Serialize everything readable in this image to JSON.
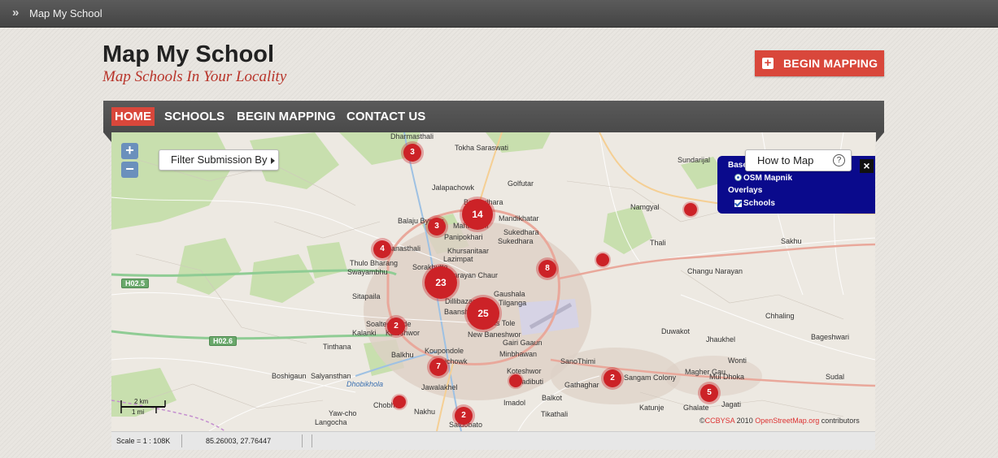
{
  "topbar": {
    "title": "Map My School"
  },
  "brand": {
    "title": "Map My School",
    "subtitle": "Map Schools In Your Locality"
  },
  "header": {
    "begin_mapping_label": "BEGIN MAPPING"
  },
  "nav": {
    "items": [
      "HOME",
      "SCHOOLS",
      "BEGIN MAPPING",
      "CONTACT US"
    ],
    "active": "HOME"
  },
  "map": {
    "zoom_in": "+",
    "zoom_out": "−",
    "filter_label": "Filter Submission By",
    "howto_label": "How to Map",
    "help_glyph": "?",
    "close_glyph": "×",
    "layers": {
      "base_header": "Base Layer",
      "base_option": "OSM Mapnik",
      "overlay_header": "Overlays",
      "overlay_option": "Schools"
    },
    "clusters": [
      "3",
      "14",
      "3",
      "4",
      "8",
      "23",
      "25",
      "2",
      "7",
      "2",
      "5",
      "2"
    ],
    "places": [
      "Dharmasthali",
      "Tokha Saraswati",
      "Golfutar",
      "Jalapachowk",
      "Basundhara",
      "Balaju Bypass",
      "Mahalaxmi",
      "Mandikhatar",
      "Panipokhari",
      "Sukedhara",
      "Sukedhara",
      "Khursanitaar",
      "Lazimpat",
      "Banasthali",
      "Thulo Bharang",
      "Swayambhu",
      "Sorakhutte",
      "Narayan Chaur",
      "Sitapaila",
      "Gaushala",
      "Dillibazar",
      "Tilganga",
      "Baanshghari",
      "Gurans Tole",
      "Soaltee Mode",
      "Kalanki",
      "Kuleshwor",
      "New Baneshwor",
      "Gairi Gaaun",
      "Tinthana",
      "Balkhu",
      "Koupondole",
      "Minbhawan",
      "SanoThimi",
      "Lichowk",
      "Koteshwor",
      "Boshigaun",
      "Salyansthan",
      "Jawalakhel",
      "Jadibuti",
      "Gathaghar",
      "Sangam Colony",
      "Chobhar",
      "Nakhu",
      "Imadol",
      "Balkot",
      "Yaw-cho",
      "Langocha",
      "Tikathali",
      "Satdobato",
      "Sundarijal",
      "Namgyal",
      "Thali",
      "Sakhu",
      "Changu Narayan",
      "Chhaling",
      "Duwakot",
      "Jhaukhel",
      "Bageshwari",
      "Wonti",
      "Magher Gau",
      "Mul Dhoka",
      "Sudal",
      "Katunje",
      "Ghalate",
      "Jagati",
      "Dhobikhola"
    ],
    "highways": [
      "H02.5",
      "H02.6"
    ],
    "scale": {
      "km": "2 km",
      "mi": "1 mi"
    },
    "attribution": {
      "prefix": "©",
      "license": "CCBYSA",
      "year": "2010",
      "source": "OpenStreetMap.org",
      "suffix": "contributors"
    }
  },
  "statusbar": {
    "scale": "Scale = 1 : 108K",
    "coords": "85.26003, 27.76447"
  },
  "colors": {
    "accent": "#d9473b",
    "cluster": "#cc2227",
    "nav": "#4f4f4f",
    "layers_bg": "#0a0a8c"
  }
}
